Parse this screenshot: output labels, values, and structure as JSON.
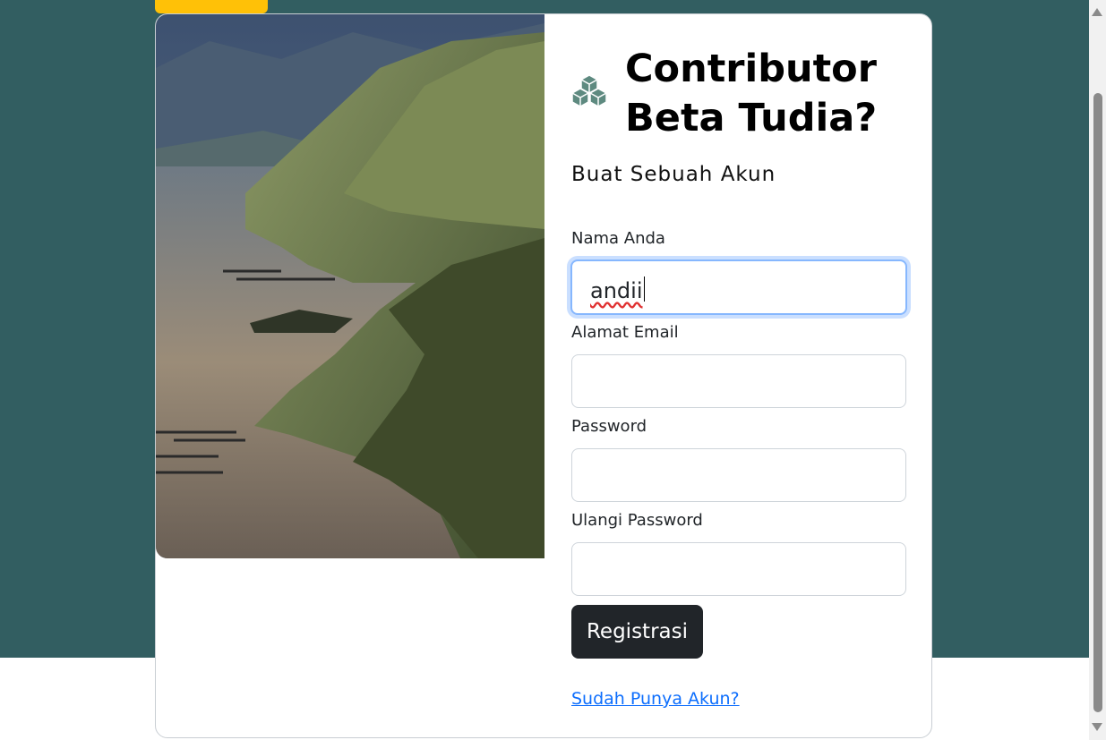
{
  "page": {
    "title": "Contributor Beta Tudia?",
    "subtitle": "Buat Sebuah Akun",
    "brand_icon": "cubes-icon"
  },
  "form": {
    "name": {
      "label": "Nama Anda",
      "value": "andii"
    },
    "email": {
      "label": "Alamat Email",
      "value": ""
    },
    "password": {
      "label": "Password",
      "value": ""
    },
    "confirm_password": {
      "label": "Ulangi Password",
      "value": ""
    },
    "submit_label": "Registrasi"
  },
  "login_link": "Sudah Punya Akun?",
  "colors": {
    "background": "#325e61",
    "accent_tab": "#ffc107",
    "button": "#212529",
    "link": "#0d6efd",
    "focus_ring": "#86b7fe"
  }
}
